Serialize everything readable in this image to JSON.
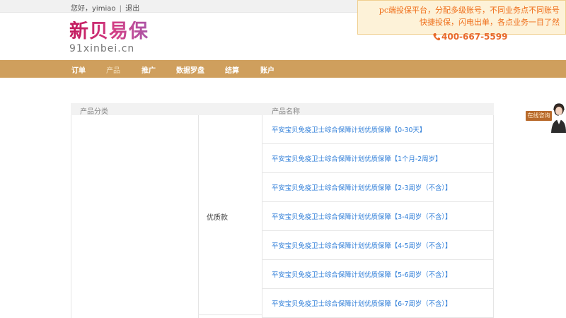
{
  "topbar": {
    "greeting": "您好，",
    "username": "yimiao",
    "separator": "|",
    "logout": "退出"
  },
  "logo": {
    "cn": "新贝易保",
    "en": "91xinbei.cn"
  },
  "phone": "400-667-5599",
  "notice": {
    "line1": "pc端投保平台，分配多级账号，不同业务点不同账号",
    "line2": "快捷投保，闪电出单，各点业务一目了然"
  },
  "nav": {
    "items": [
      "订单",
      "产品",
      "推广",
      "数据罗盘",
      "结算",
      "账户"
    ],
    "active": "产品"
  },
  "table": {
    "headers": [
      "产品分类",
      "产品名称"
    ],
    "subcategory": "优质款",
    "rows": [
      "平安宝贝免疫卫士综合保障计划优质保障【0-30天】",
      "平安宝贝免疫卫士综合保障计划优质保障【1个月-2周岁】",
      "平安宝贝免疫卫士综合保障计划优质保障【2-3周岁（不含）】",
      "平安宝贝免疫卫士综合保障计划优质保障【3-4周岁（不含）】",
      "平安宝贝免疫卫士综合保障计划优质保障【4-5周岁（不含）】",
      "平安宝贝免疫卫士综合保障计划优质保障【5-6周岁（不含）】",
      "平安宝贝免疫卫士综合保障计划优质保障【6-7周岁（不含）】"
    ]
  },
  "chat": {
    "label": "在线咨询"
  },
  "colors": {
    "nav_bg": "#cf9f5d",
    "link": "#2f7ed8",
    "notice_text": "#ef6d18",
    "phone": "#e8692a"
  }
}
